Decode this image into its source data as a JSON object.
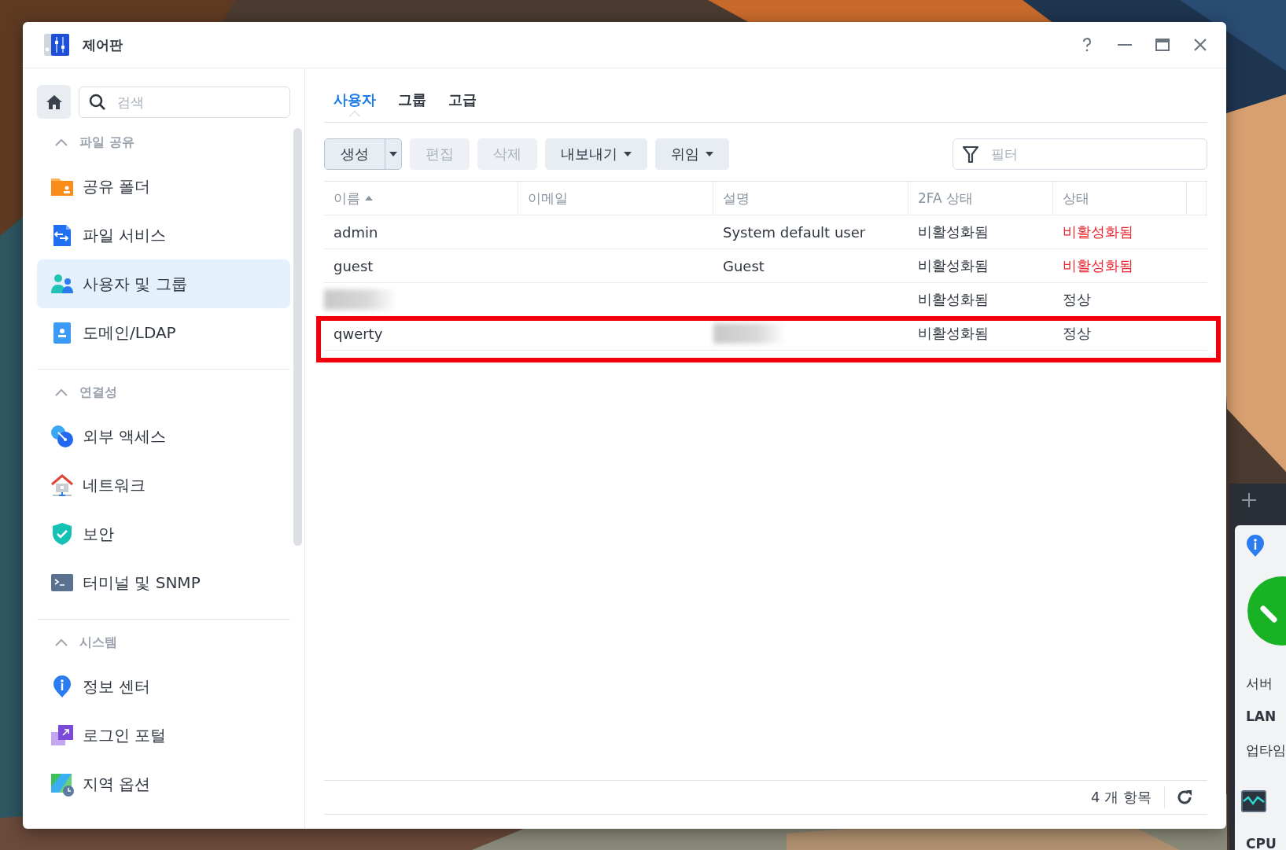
{
  "window": {
    "title": "제어판"
  },
  "sidebar": {
    "search": {
      "placeholder": "검색"
    },
    "sections": [
      {
        "title": "파일 공유",
        "expanded": true,
        "items": [
          {
            "label": "공유 폴더",
            "selected": false
          },
          {
            "label": "파일 서비스",
            "selected": false
          },
          {
            "label": "사용자 및 그룹",
            "selected": true
          },
          {
            "label": "도메인/LDAP",
            "selected": false
          }
        ]
      },
      {
        "title": "연결성",
        "expanded": true,
        "items": [
          {
            "label": "외부 액세스",
            "selected": false
          },
          {
            "label": "네트워크",
            "selected": false
          },
          {
            "label": "보안",
            "selected": false
          },
          {
            "label": "터미널 및 SNMP",
            "selected": false
          }
        ]
      },
      {
        "title": "시스템",
        "expanded": true,
        "items": [
          {
            "label": "정보 센터",
            "selected": false
          },
          {
            "label": "로그인 포털",
            "selected": false
          },
          {
            "label": "지역 옵션",
            "selected": false
          }
        ]
      }
    ]
  },
  "tabs": [
    {
      "label": "사용자",
      "selected": true
    },
    {
      "label": "그룹",
      "selected": false
    },
    {
      "label": "고급",
      "selected": false
    }
  ],
  "toolbar": {
    "buttons": [
      {
        "label": "생성",
        "kind": "split",
        "disabled": false
      },
      {
        "label": "편집",
        "kind": "plain",
        "disabled": true
      },
      {
        "label": "삭제",
        "kind": "plain",
        "disabled": true
      },
      {
        "label": "내보내기",
        "kind": "menu",
        "disabled": false
      },
      {
        "label": "위임",
        "kind": "menu",
        "disabled": false
      }
    ],
    "filter": {
      "placeholder": "필터"
    }
  },
  "table": {
    "columns": [
      {
        "label": "이름",
        "sorted": true
      },
      {
        "label": "이메일",
        "sorted": false
      },
      {
        "label": "설명",
        "sorted": false
      },
      {
        "label": "2FA 상태",
        "sorted": false
      },
      {
        "label": "상태",
        "sorted": false
      }
    ],
    "rows": [
      {
        "name": "admin",
        "description": "System default user",
        "twofa": "비활성화됨",
        "status": {
          "text": "비활성화됨",
          "color": "#e8262d"
        },
        "name_redacted": false,
        "description_redacted": false,
        "highlighted": false
      },
      {
        "name": "guest",
        "description": "Guest",
        "twofa": "비활성화됨",
        "status": {
          "text": "비활성화됨",
          "color": "#e8262d"
        },
        "name_redacted": false,
        "description_redacted": false,
        "highlighted": false
      },
      {
        "twofa": "비활성화됨",
        "status": {
          "text": "정상",
          "color": "#333b45"
        },
        "name_redacted": true,
        "description_redacted": false,
        "highlighted": false
      },
      {
        "name": "qwerty",
        "twofa": "비활성화됨",
        "status": {
          "text": "정상",
          "color": "#333b45"
        },
        "name_redacted": false,
        "description_redacted": true,
        "highlighted": true
      }
    ]
  },
  "footer": {
    "count": "4 개 항목"
  },
  "widgets": [
    {
      "kind": "system",
      "lines": [
        {
          "text": "서버",
          "kind": "label"
        },
        {
          "text": "LAN",
          "kind": "heading"
        },
        {
          "text": "업타임",
          "kind": "label"
        }
      ]
    },
    {
      "kind": "resource",
      "lines": [
        {
          "text": "CPU",
          "kind": "heading"
        }
      ]
    }
  ]
}
